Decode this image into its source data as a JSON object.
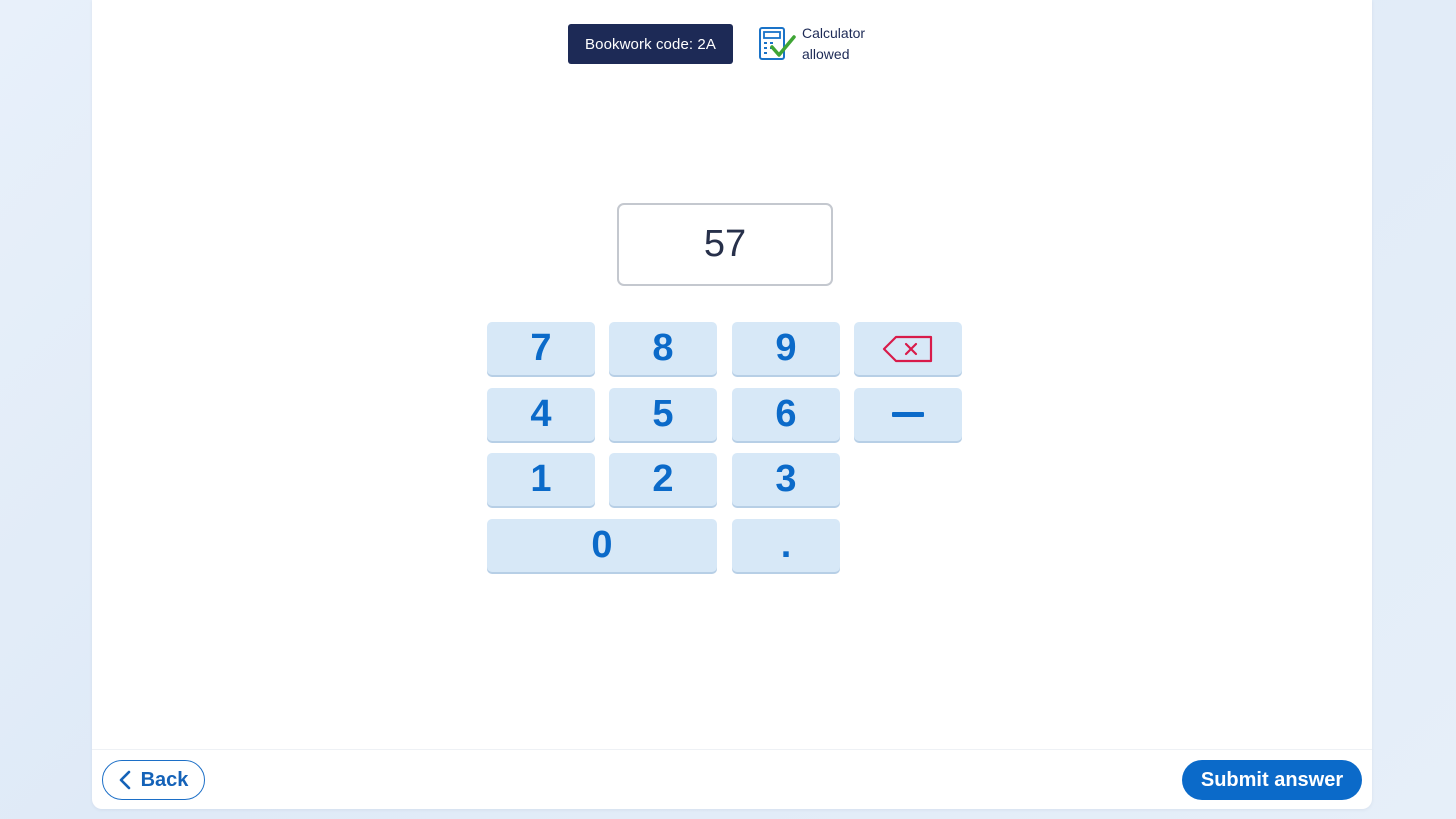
{
  "header": {
    "bookwork_label": "Bookwork code: 2A",
    "calculator_line1": "Calculator",
    "calculator_line2": "allowed"
  },
  "answer": {
    "value": "57"
  },
  "keypad": {
    "k7": "7",
    "k8": "8",
    "k9": "9",
    "k4": "4",
    "k5": "5",
    "k6": "6",
    "k1": "1",
    "k2": "2",
    "k3": "3",
    "k0": "0",
    "decimal": ".",
    "backspace_icon": "backspace-icon",
    "minus_icon": "minus-icon"
  },
  "footer": {
    "back_label": "Back",
    "submit_label": "Submit answer"
  },
  "colors": {
    "primary": "#0b6ac9",
    "bookwork_bg": "#1d2a56",
    "key_bg": "#d7e8f7",
    "backspace": "#d81b4a",
    "check": "#3fa535"
  }
}
